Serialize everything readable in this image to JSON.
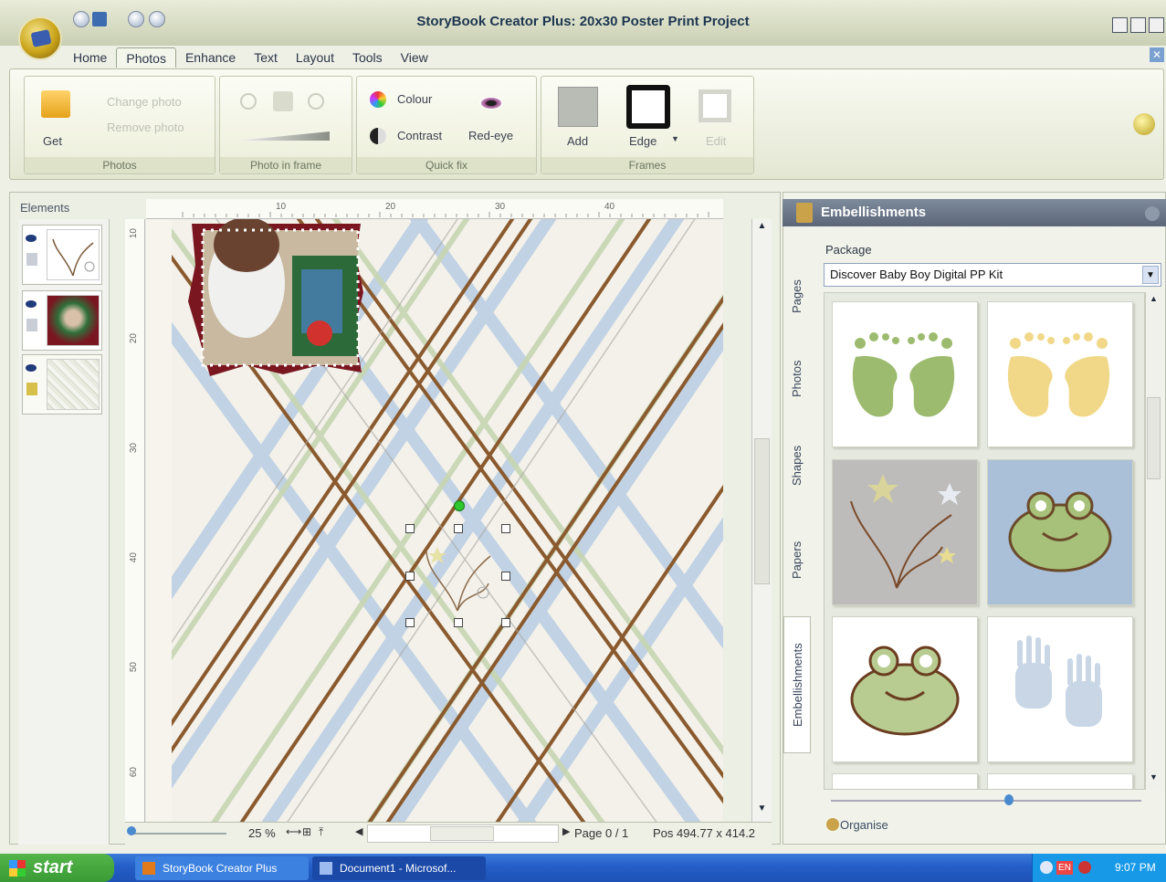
{
  "window": {
    "title": "StoryBook Creator Plus: 20x30 Poster Print Project"
  },
  "menu_tabs": [
    "Home",
    "Photos",
    "Enhance",
    "Text",
    "Layout",
    "Tools",
    "View"
  ],
  "active_tab": "Photos",
  "ribbon": {
    "photos_group": {
      "label": "Photos",
      "get": "Get",
      "change_photo": "Change photo",
      "remove_photo": "Remove photo"
    },
    "photo_in_frame_group": {
      "label": "Photo in frame"
    },
    "quick_fix_group": {
      "label": "Quick fix",
      "colour": "Colour",
      "contrast": "Contrast",
      "red_eye": "Red-eye"
    },
    "frames_group": {
      "label": "Frames",
      "add": "Add",
      "edge": "Edge",
      "edit": "Edit"
    }
  },
  "elements_panel": {
    "title": "Elements"
  },
  "rulers": {
    "horizontal": [
      "10",
      "20",
      "30",
      "40"
    ],
    "vertical": [
      "10",
      "20",
      "30",
      "40",
      "50",
      "60"
    ]
  },
  "statusbar": {
    "zoom": "25 %",
    "page": "Page 0 / 1",
    "pos": "Pos 494.77 x 414.2"
  },
  "right_pane": {
    "header": "Embellishments",
    "tabs": [
      "Pages",
      "Photos",
      "Shapes",
      "Papers",
      "Embellishments"
    ],
    "package_label": "Package",
    "package_value": "Discover Baby Boy Digital PP Kit",
    "tiles": [
      "green-footprints",
      "yellow-footprints",
      "stars-flourish",
      "blue-frog-tile",
      "green-frog",
      "blue-handprints"
    ],
    "organise": "Organise"
  },
  "taskbar": {
    "start": "start",
    "tasks": [
      "StoryBook Creator Plus",
      "Document1 - Microsof..."
    ],
    "tray_lang": "EN",
    "clock": "9:07 PM"
  },
  "colors": {
    "accent": "#5b6778",
    "taskbar": "#245ec7",
    "start": "#3a9a35",
    "plaid_brown": "#8a5a2e",
    "plaid_blue": "#b9cde3",
    "plaid_green": "#c7d6b2"
  }
}
